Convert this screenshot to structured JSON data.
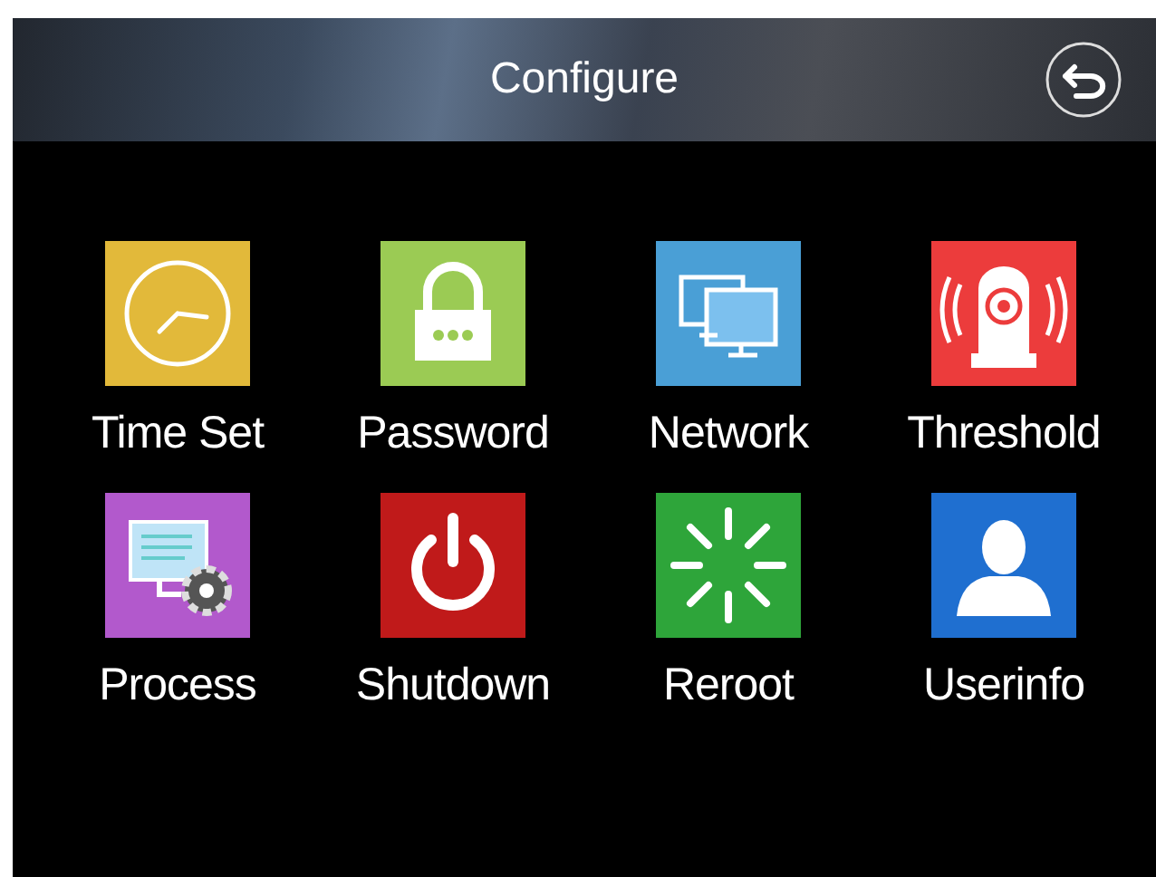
{
  "header": {
    "title": "Configure"
  },
  "items": [
    {
      "kind": "clock",
      "label": "Time Set",
      "color": "#e2b93a"
    },
    {
      "kind": "lock",
      "label": "Password",
      "color": "#9bcb54"
    },
    {
      "kind": "monitors",
      "label": "Network",
      "color": "#4a9fd6"
    },
    {
      "kind": "alarm",
      "label": "Threshold",
      "color": "#ec3c3c"
    },
    {
      "kind": "process",
      "label": "Process",
      "color": "#b259cc"
    },
    {
      "kind": "power",
      "label": "Shutdown",
      "color": "#c01a1a"
    },
    {
      "kind": "spinner",
      "label": "Reroot",
      "color": "#2ea53a"
    },
    {
      "kind": "user",
      "label": "Userinfo",
      "color": "#1f6fd0"
    }
  ]
}
